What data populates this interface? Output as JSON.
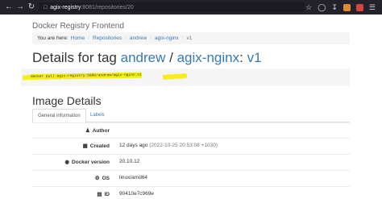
{
  "browser": {
    "back_icon": "arrow-left-icon",
    "forward_icon": "arrow-right-icon",
    "reload_icon": "reload-icon",
    "url_host": "agix-registry",
    "url_path": ":8081/repositories/20",
    "star_icon": "star-icon",
    "download_icon": "download-icon",
    "menu_icon": "hamburger-menu-icon"
  },
  "page": {
    "brand": "Docker Registry Frontend",
    "breadcrumb": {
      "prefix": "You are here:",
      "items": [
        "Home",
        "Repositories",
        "andrew",
        "agix-nginx",
        "v1"
      ]
    },
    "title": {
      "prefix": "Details for tag",
      "repo_user": "andrew",
      "slash": "/",
      "repo_name": "agix-nginx",
      "colon": ":",
      "tag": "v1"
    },
    "command": "docker pull agix-registry:5000/andrew/agix-nginx:v1",
    "section_title": "Image Details",
    "tabs": [
      "General information",
      "Labels"
    ],
    "details": [
      {
        "icon": "user-icon",
        "label": "Author",
        "value": "",
        "extra": ""
      },
      {
        "icon": "calendar-icon",
        "label": "Created",
        "value": "12 days ago",
        "extra": "(2022-10-25 20:53:08 +1030)"
      },
      {
        "icon": "docker-icon",
        "label": "Docker version",
        "value": "20.10.12",
        "extra": ""
      },
      {
        "icon": "gear-icon",
        "label": "OS",
        "value": "linux/amd64",
        "extra": ""
      },
      {
        "icon": "id-icon",
        "label": "ID",
        "value": "90410e7c969e",
        "extra": ""
      }
    ]
  },
  "colors": {
    "link": "#337ab7",
    "highlight": "#f5ee1b",
    "chrome": "#23222b"
  }
}
